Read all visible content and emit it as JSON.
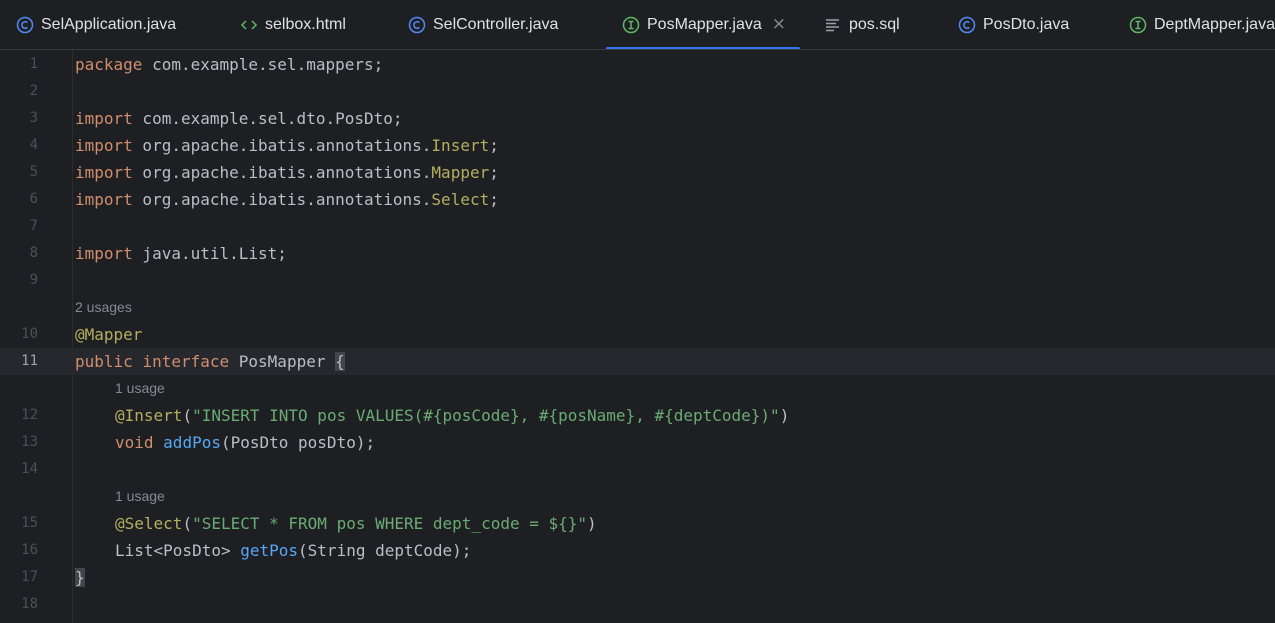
{
  "tabs": [
    {
      "label": "SelApplication.java",
      "icon": "class-icon",
      "active": false
    },
    {
      "label": "selbox.html",
      "icon": "html-icon",
      "active": false
    },
    {
      "label": "SelController.java",
      "icon": "class-icon",
      "active": false
    },
    {
      "label": "PosMapper.java",
      "icon": "interface-icon",
      "active": true
    },
    {
      "label": "pos.sql",
      "icon": "sql-file-icon",
      "active": false
    },
    {
      "label": "PosDto.java",
      "icon": "class-icon",
      "active": false
    },
    {
      "label": "DeptMapper.java",
      "icon": "interface-icon",
      "active": false
    }
  ],
  "colors": {
    "accent": "#3574f0",
    "keyword": "#cf8e6d",
    "annotation": "#b3ae60",
    "string": "#6aab73",
    "method": "#56a8f5",
    "interface_icon": "#5fb865",
    "class_icon": "#548af7"
  },
  "editor": {
    "current_line": "11",
    "line_numbers": [
      "1",
      "2",
      "3",
      "4",
      "5",
      "6",
      "7",
      "8",
      "9",
      "10",
      "11",
      "12",
      "13",
      "14",
      "15",
      "16",
      "17",
      "18"
    ],
    "hints": {
      "h10": "2 usages",
      "h12": "1 usage",
      "h15": "1 usage"
    },
    "code": {
      "l1": {
        "kw": "package",
        "rest": " com.example.sel.mappers;"
      },
      "l3": {
        "kw": "import",
        "rest": " com.example.sel.dto.PosDto;"
      },
      "l4": {
        "kw": "import",
        "rest": " org.apache.ibatis.annotations.",
        "ann": "Insert",
        "end": ";"
      },
      "l5": {
        "kw": "import",
        "rest": " org.apache.ibatis.annotations.",
        "ann": "Mapper",
        "end": ";"
      },
      "l6": {
        "kw": "import",
        "rest": " org.apache.ibatis.annotations.",
        "ann": "Select",
        "end": ";"
      },
      "l8": {
        "kw": "import",
        "rest": " java.util.List;"
      },
      "l10": {
        "ann": "@Mapper"
      },
      "l11": {
        "kw1": "public",
        "kw2": "interface",
        "name": " PosMapper ",
        "brace": "{"
      },
      "l12": {
        "ann": "@Insert",
        "open": "(",
        "str": "\"INSERT INTO pos VALUES(#{posCode}, #{posName}, #{deptCode})\"",
        "close": ")"
      },
      "l13": {
        "kw": "void",
        "fn": "addPos",
        "rest": "(PosDto posDto);"
      },
      "l15": {
        "ann": "@Select",
        "open": "(",
        "str": "\"SELECT * FROM pos WHERE dept_code = ${}\"",
        "close": ")"
      },
      "l16": {
        "pre": "List<PosDto> ",
        "fn": "getPos",
        "rest": "(String deptCode);"
      },
      "l17": {
        "brace": "}"
      }
    }
  }
}
